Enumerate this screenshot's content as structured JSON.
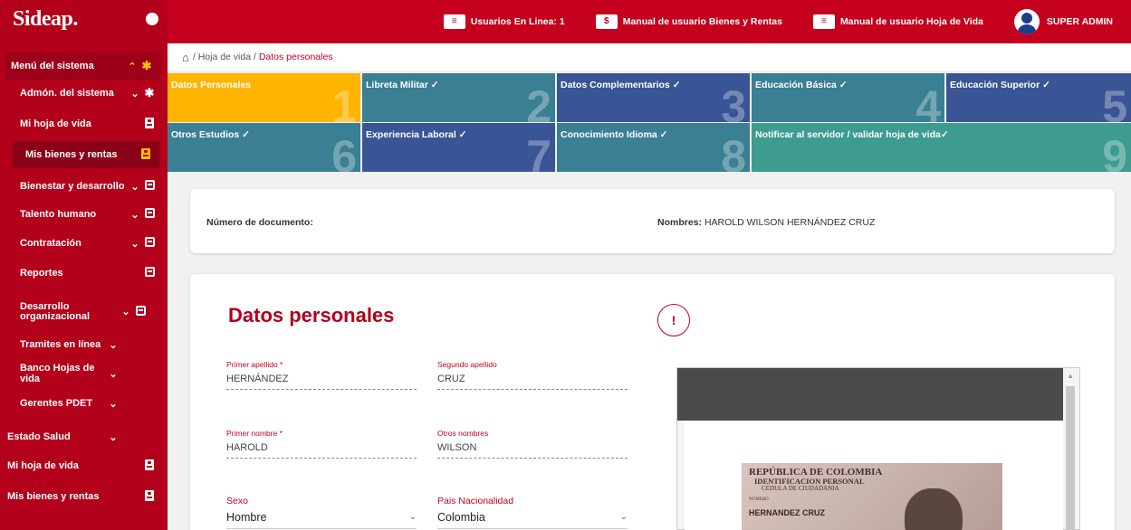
{
  "app": {
    "logo": "Sideap."
  },
  "topbar": {
    "online_users": "Usuarios En Linea: 1",
    "manual_bienes": "Manual de usuario Bienes y Rentas",
    "manual_hoja": "Manual de usuario Hoja de Vida",
    "user": "SUPER ADMIN",
    "icon_users": "≡",
    "icon_money": "$"
  },
  "sidebar": {
    "items": [
      {
        "label": "Menú del sistema"
      },
      {
        "label": "Admón. del sistema"
      },
      {
        "label": "Mi hoja de vida"
      },
      {
        "label": "Mis bienes y rentas"
      },
      {
        "label": "Bienestar y desarrollo"
      },
      {
        "label": "Talento humano"
      },
      {
        "label": "Contratación"
      },
      {
        "label": "Reportes"
      },
      {
        "label": "Desarrollo organizacional"
      },
      {
        "label": "Tramites en línea"
      },
      {
        "label": "Banco Hojas de vida"
      },
      {
        "label": "Gerentes PDET"
      },
      {
        "label": "Estado Salud"
      },
      {
        "label": "Mi hoja de vida"
      },
      {
        "label": "Mis bienes y rentas"
      }
    ]
  },
  "breadcrumb": {
    "path": "/ Hoja de vida /",
    "current": "Datos personales"
  },
  "steps": [
    {
      "label": "Datos Personales",
      "num": "1"
    },
    {
      "label": "Libreta Militar ✓",
      "num": "2"
    },
    {
      "label": "Datos Complementarios ✓",
      "num": "3"
    },
    {
      "label": "Educación Básica ✓",
      "num": "4"
    },
    {
      "label": "Educación Superior ✓",
      "num": "5"
    },
    {
      "label": "Otros Estudios ✓",
      "num": "6"
    },
    {
      "label": "Experiencia Laboral ✓",
      "num": "7"
    },
    {
      "label": "Conocimiento Idioma ✓",
      "num": "8"
    },
    {
      "label": "Notificar al servidor / validar hoja de vida✓",
      "num": "9"
    }
  ],
  "info": {
    "doc_label": "Número de documento:",
    "doc_value": "",
    "name_label": "Nombres:",
    "name_value": "HAROLD WILSON HERNÁNDEZ CRUZ"
  },
  "form": {
    "title": "Datos personales",
    "alert_icon": "!",
    "primer_apellido": {
      "label": "Primer apellido *",
      "value": "HERNÁNDEZ"
    },
    "segundo_apellido": {
      "label": "Segundo apellido",
      "value": "CRUZ"
    },
    "primer_nombre": {
      "label": "Primer nombre *",
      "value": "HAROLD"
    },
    "otros_nombres": {
      "label": "Otros nombres",
      "value": "WILSON"
    },
    "sexo": {
      "label": "Sexo",
      "value": "Hombre"
    },
    "pais": {
      "label": "Pais Nacionalidad",
      "value": "Colombia"
    }
  },
  "document_preview": {
    "line1": "REPÚBLICA DE COLOMBIA",
    "line2": "IDENTIFICACION PERSONAL",
    "line3": "CEDULA DE CIUDADANIA",
    "line4": "NUMERO",
    "line5": "HERNANDEZ CRUZ"
  }
}
